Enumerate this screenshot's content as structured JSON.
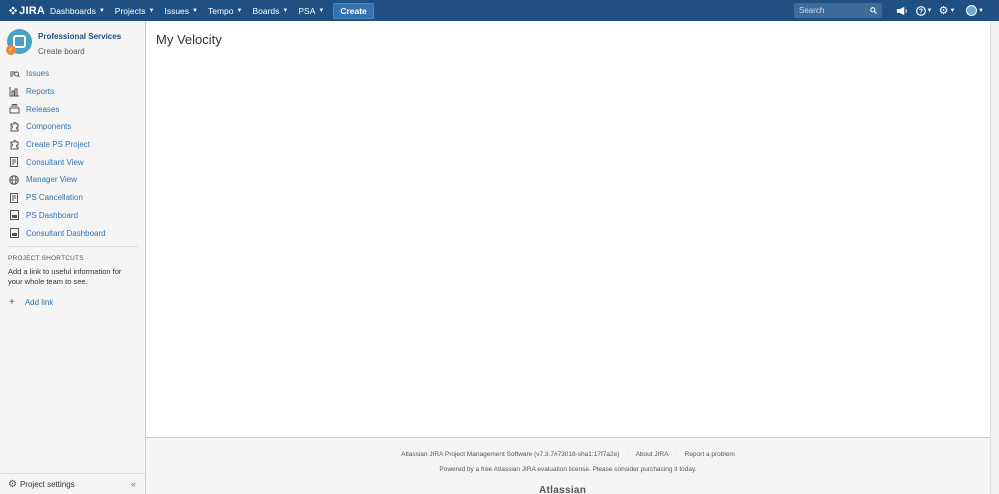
{
  "nav": {
    "brand": "JIRA",
    "items": [
      {
        "label": "Dashboards"
      },
      {
        "label": "Projects"
      },
      {
        "label": "Issues"
      },
      {
        "label": "Tempo"
      },
      {
        "label": "Boards"
      },
      {
        "label": "PSA"
      }
    ],
    "create_label": "Create",
    "search_placeholder": "Search",
    "accent": "#205081"
  },
  "sidebar": {
    "project_name": "Professional Services",
    "project_sub": "Create board",
    "items": [
      {
        "label": "Issues",
        "icon": "issues-icon"
      },
      {
        "label": "Reports",
        "icon": "reports-icon"
      },
      {
        "label": "Releases",
        "icon": "releases-icon"
      },
      {
        "label": "Components",
        "icon": "components-icon"
      },
      {
        "label": "Create PS Project",
        "icon": "puzzle-icon"
      },
      {
        "label": "Consultant View",
        "icon": "report-page-icon"
      },
      {
        "label": "Manager View",
        "icon": "globe-icon"
      },
      {
        "label": "PS Cancellation",
        "icon": "report-page-icon"
      },
      {
        "label": "PS Dashboard",
        "icon": "dashboard-page-icon"
      },
      {
        "label": "Consultant Dashboard",
        "icon": "dashboard-page-icon"
      }
    ],
    "shortcuts_heading": "PROJECT SHORTCUTS",
    "shortcuts_text": "Add a link to useful information for your whole team to see.",
    "add_link_label": "Add link",
    "settings_label": "Project settings"
  },
  "main": {
    "title": "My Velocity"
  },
  "footer": {
    "software": "Atlassian JIRA Project Management Software (v7.3.7#73018-sha1:17f7a2e)",
    "about": "About JIRA",
    "report": "Report a problem",
    "note": "Powered by a free Atlassian JIRA evaluation license. Please consider purchasing it today.",
    "logo": "Atlassian"
  }
}
